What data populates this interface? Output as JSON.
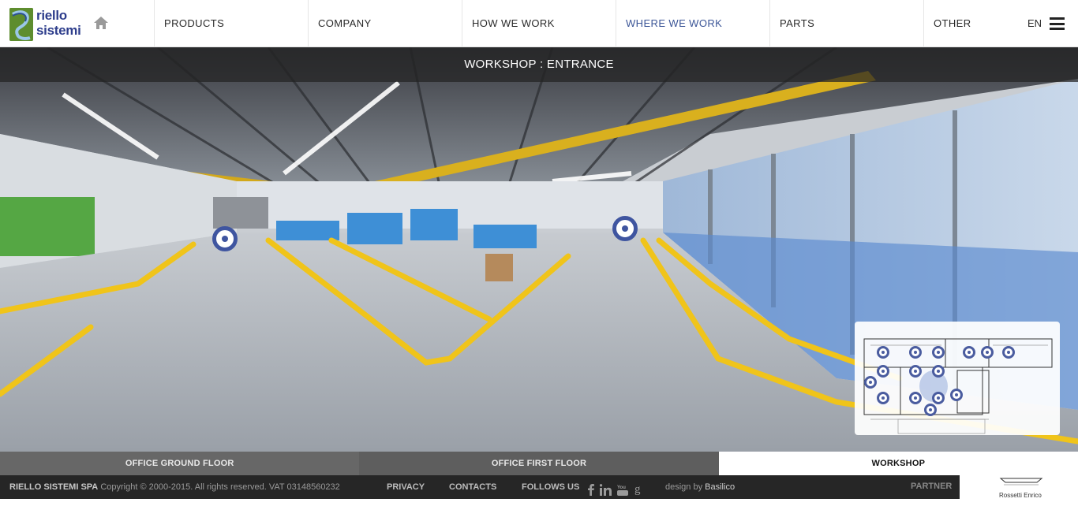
{
  "header": {
    "logo_text_line1": "riello",
    "logo_text_line2": "sistemi",
    "nav": [
      {
        "label": "PRODUCTS"
      },
      {
        "label": "COMPANY"
      },
      {
        "label": "HOW WE WORK"
      },
      {
        "label": "WHERE WE WORK",
        "active": true
      },
      {
        "label": "PARTS"
      },
      {
        "label": "OTHER"
      }
    ],
    "language": "EN"
  },
  "panorama": {
    "title": "WORKSHOP : ENTRANCE",
    "hotspot_count": 2,
    "minimap_hotspot_count": 15
  },
  "floor_tabs": [
    {
      "label": "OFFICE GROUND FLOOR"
    },
    {
      "label": "OFFICE FIRST FLOOR"
    },
    {
      "label": "WORKSHOP",
      "active": true
    }
  ],
  "footer": {
    "company": "RIELLO SISTEMI SPA",
    "copyright": "Copyright © 2000-2015. All rights reserved. VAT 03148560232",
    "privacy": "PRIVACY",
    "contacts": "CONTACTS",
    "follow_us": "FOLLOWS US",
    "social_icons": [
      "facebook-icon",
      "linkedin-icon",
      "youtube-icon",
      "googleplus-icon"
    ],
    "design_by_prefix": "design by",
    "design_by_name": "Basilico",
    "partner_label": "PARTNER",
    "partner_name": "Rossetti Enrico"
  },
  "colors": {
    "accent_blue": "#3f55a0",
    "floor_yellow": "#f4c91a",
    "tab_active_bg": "#ffffff",
    "footer_bg": "#262626"
  }
}
